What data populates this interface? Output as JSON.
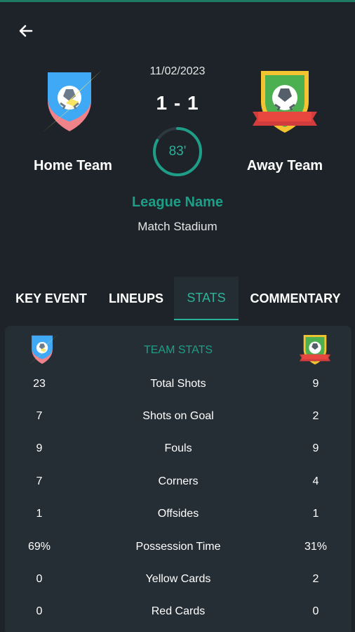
{
  "colors": {
    "accent": "#2bb29a",
    "background": "#1d2329",
    "card": "#262e35"
  },
  "header": {
    "back_icon": "arrow-left-icon",
    "date": "11/02/2023",
    "score": "1 - 1",
    "minute": "83'",
    "minute_progress": 0.83,
    "league": "League Name",
    "stadium": "Match Stadium",
    "home_team": "Home Team",
    "away_team": "Away Team"
  },
  "tabs": [
    {
      "label": "KEY EVENT",
      "active": false
    },
    {
      "label": "LINEUPS",
      "active": false
    },
    {
      "label": "STATS",
      "active": true
    },
    {
      "label": "COMMENTARY",
      "active": false
    }
  ],
  "stats": {
    "title": "TEAM STATS",
    "rows": [
      {
        "home": "23",
        "label": "Total Shots",
        "away": "9"
      },
      {
        "home": "7",
        "label": "Shots on Goal",
        "away": "2"
      },
      {
        "home": "9",
        "label": "Fouls",
        "away": "9"
      },
      {
        "home": "7",
        "label": "Corners",
        "away": "4"
      },
      {
        "home": "1",
        "label": "Offsides",
        "away": "1"
      },
      {
        "home": "69%",
        "label": "Possession Time",
        "away": "31%"
      },
      {
        "home": "0",
        "label": "Yellow Cards",
        "away": "2"
      },
      {
        "home": "0",
        "label": "Red Cards",
        "away": "0"
      }
    ]
  }
}
